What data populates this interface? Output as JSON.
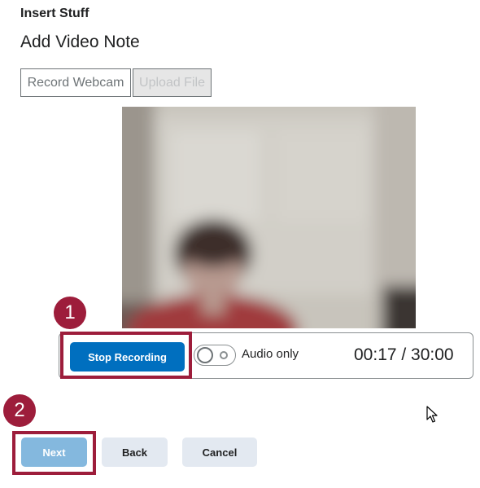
{
  "dialog": {
    "title": "Insert Stuff",
    "subtitle": "Add Video Note"
  },
  "tabs": [
    {
      "label": "Record Webcam",
      "state": "active"
    },
    {
      "label": "Upload File",
      "state": "disabled"
    }
  ],
  "recorder": {
    "stop_label": "Stop Recording",
    "audio_only_label": "Audio only",
    "audio_only_checked": false,
    "elapsed": "00:17",
    "separator": "/",
    "limit": "30:00",
    "timer_text": "00:17 / 30:00"
  },
  "callouts": {
    "step1": "1",
    "step2": "2",
    "color": "#9d1d3b"
  },
  "footer": {
    "next_label": "Next",
    "back_label": "Back",
    "cancel_label": "Cancel"
  },
  "colors": {
    "primary": "#006fbf",
    "primary_disabled": "#84b8de",
    "secondary_bg": "#e3e9f1"
  }
}
